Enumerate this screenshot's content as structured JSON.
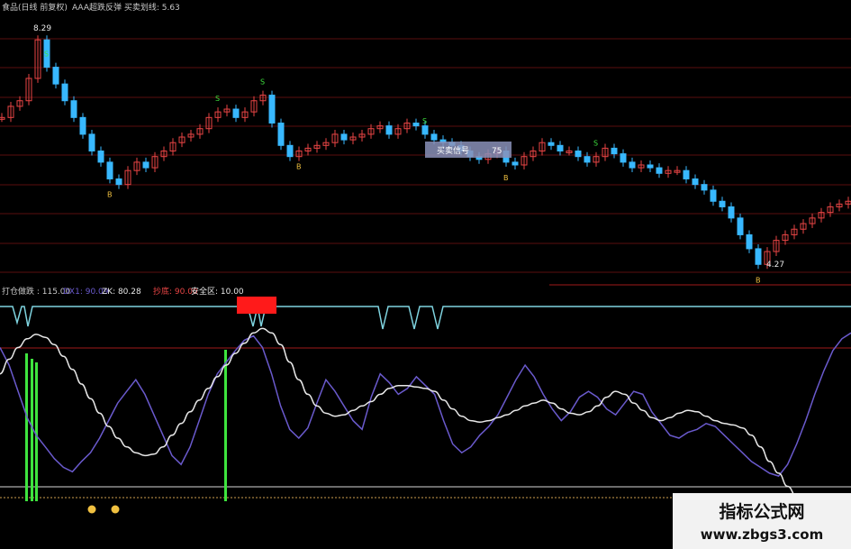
{
  "header": {
    "title": "食品(日线 前复权)",
    "indicator": "AAA超跌反弹 买卖划线: 5.63"
  },
  "indicator_bar": {
    "l1": "打仓做跌 : 115.00",
    "l2": "DX1: 90.09",
    "l3": "ZK: 80.28",
    "l4": "抄底: 90.00",
    "l5": "安全区: 10.00"
  },
  "price_overlay": {
    "tooltip": "买卖信号",
    "tooltip_value": "75"
  },
  "signal_marks": [
    "S",
    "B"
  ],
  "watermark": {
    "line1": "指标公式网",
    "line2": "www.zbgs3.com"
  },
  "colors": {
    "up_candle": "#e84545",
    "down_candle": "#38b8ff",
    "white_line": "#e8e8e8",
    "purple_line": "#6a5acd",
    "green_bar": "#3ee43e",
    "red_block": "#ff1a1a",
    "cyan_line": "#7fd4e0",
    "grid_red": "#7a1414"
  },
  "chart_data": [
    {
      "type": "line",
      "title": "",
      "annotations": [
        {
          "label": "8.29",
          "value": 8.29
        },
        {
          "label": "4.27",
          "value": 4.27
        }
      ],
      "x": [
        0,
        1,
        2,
        3,
        4,
        5,
        6,
        7,
        8,
        9,
        10,
        11,
        12,
        13,
        14,
        15,
        16,
        17,
        18,
        19,
        20,
        21,
        22,
        23,
        24,
        25,
        26,
        27,
        28,
        29,
        30,
        31,
        32,
        33,
        34,
        35,
        36,
        37,
        38,
        39,
        40,
        41,
        42,
        43,
        44,
        45,
        46,
        47,
        48,
        49,
        50,
        51,
        52,
        53,
        54,
        55,
        56,
        57,
        58,
        59,
        60,
        61,
        62,
        63,
        64,
        65,
        66,
        67,
        68,
        69,
        70,
        71,
        72,
        73,
        74,
        75,
        76,
        77,
        78,
        79,
        80,
        81,
        82,
        83,
        84,
        85,
        86,
        87,
        88,
        89,
        90,
        91,
        92,
        93,
        94
      ],
      "series": [
        {
          "values": [
            6.9,
            7.1,
            7.2,
            7.6,
            8.29,
            7.8,
            7.5,
            7.2,
            6.9,
            6.6,
            6.3,
            6.1,
            5.8,
            5.7,
            5.95,
            6.1,
            6.0,
            6.2,
            6.3,
            6.45,
            6.55,
            6.6,
            6.7,
            6.9,
            7.0,
            7.05,
            6.9,
            7.0,
            7.2,
            7.3,
            6.8,
            6.4,
            6.2,
            6.3,
            6.35,
            6.4,
            6.45,
            6.6,
            6.5,
            6.55,
            6.6,
            6.7,
            6.75,
            6.6,
            6.7,
            6.8,
            6.75,
            6.6,
            6.5,
            6.45,
            6.4,
            6.3,
            6.2,
            6.15,
            6.25,
            6.3,
            6.1,
            6.05,
            6.2,
            6.3,
            6.45,
            6.4,
            6.3,
            6.3,
            6.2,
            6.1,
            6.2,
            6.35,
            6.25,
            6.1,
            6.0,
            6.05,
            6.0,
            5.9,
            5.95,
            5.95,
            5.8,
            5.7,
            5.6,
            5.4,
            5.3,
            5.1,
            4.8,
            4.55,
            4.27,
            4.5,
            4.7,
            4.8,
            4.9,
            5.0,
            5.1,
            5.2,
            5.3,
            5.35,
            5.4
          ]
        }
      ],
      "ylim": [
        4.0,
        8.6
      ]
    },
    {
      "type": "line",
      "title": "",
      "x": [
        0,
        1,
        2,
        3,
        4,
        5,
        6,
        7,
        8,
        9,
        10,
        11,
        12,
        13,
        14,
        15,
        16,
        17,
        18,
        19,
        20,
        21,
        22,
        23,
        24,
        25,
        26,
        27,
        28,
        29,
        30,
        31,
        32,
        33,
        34,
        35,
        36,
        37,
        38,
        39,
        40,
        41,
        42,
        43,
        44,
        45,
        46,
        47,
        48,
        49,
        50,
        51,
        52,
        53,
        54,
        55,
        56,
        57,
        58,
        59,
        60,
        61,
        62,
        63,
        64,
        65,
        66,
        67,
        68,
        69,
        70,
        71,
        72,
        73,
        74,
        75,
        76,
        77,
        78,
        79,
        80,
        81,
        82,
        83,
        84,
        85,
        86,
        87,
        88,
        89,
        90,
        91,
        92,
        93,
        94
      ],
      "series": [
        {
          "values": [
            72,
            82,
            90,
            96,
            99,
            97,
            92,
            84,
            75,
            65,
            55,
            45,
            36,
            28,
            22,
            18,
            16,
            17,
            22,
            30,
            38,
            46,
            54,
            62,
            70,
            78,
            86,
            93,
            100,
            103,
            100,
            92,
            80,
            68,
            58,
            50,
            45,
            43,
            44,
            47,
            50,
            53,
            58,
            62,
            64,
            64,
            63,
            62,
            60,
            54,
            48,
            43,
            40,
            39,
            40,
            42,
            44,
            47,
            50,
            52,
            54,
            52,
            48,
            45,
            44,
            46,
            50,
            56,
            60,
            58,
            52,
            47,
            42,
            40,
            42,
            45,
            47,
            46,
            43,
            40,
            38,
            37,
            35,
            30,
            22,
            12,
            4,
            -5,
            -12,
            -18,
            -22,
            -25,
            -26,
            -24,
            -20
          ]
        },
        {
          "values": [
            90,
            78,
            60,
            42,
            30,
            22,
            14,
            8,
            5,
            12,
            18,
            28,
            40,
            52,
            60,
            68,
            58,
            44,
            30,
            16,
            10,
            22,
            40,
            58,
            72,
            80,
            88,
            95,
            98,
            90,
            72,
            50,
            34,
            28,
            35,
            52,
            68,
            60,
            50,
            40,
            34,
            56,
            72,
            66,
            58,
            62,
            70,
            64,
            58,
            40,
            24,
            18,
            22,
            30,
            36,
            44,
            56,
            68,
            78,
            70,
            58,
            48,
            40,
            46,
            56,
            60,
            56,
            48,
            44,
            52,
            60,
            58,
            46,
            38,
            30,
            28,
            32,
            34,
            38,
            36,
            30,
            24,
            18,
            12,
            8,
            4,
            2,
            10,
            24,
            40,
            58,
            74,
            88,
            96,
            100
          ]
        }
      ],
      "ylim": [
        -30,
        115
      ]
    }
  ]
}
